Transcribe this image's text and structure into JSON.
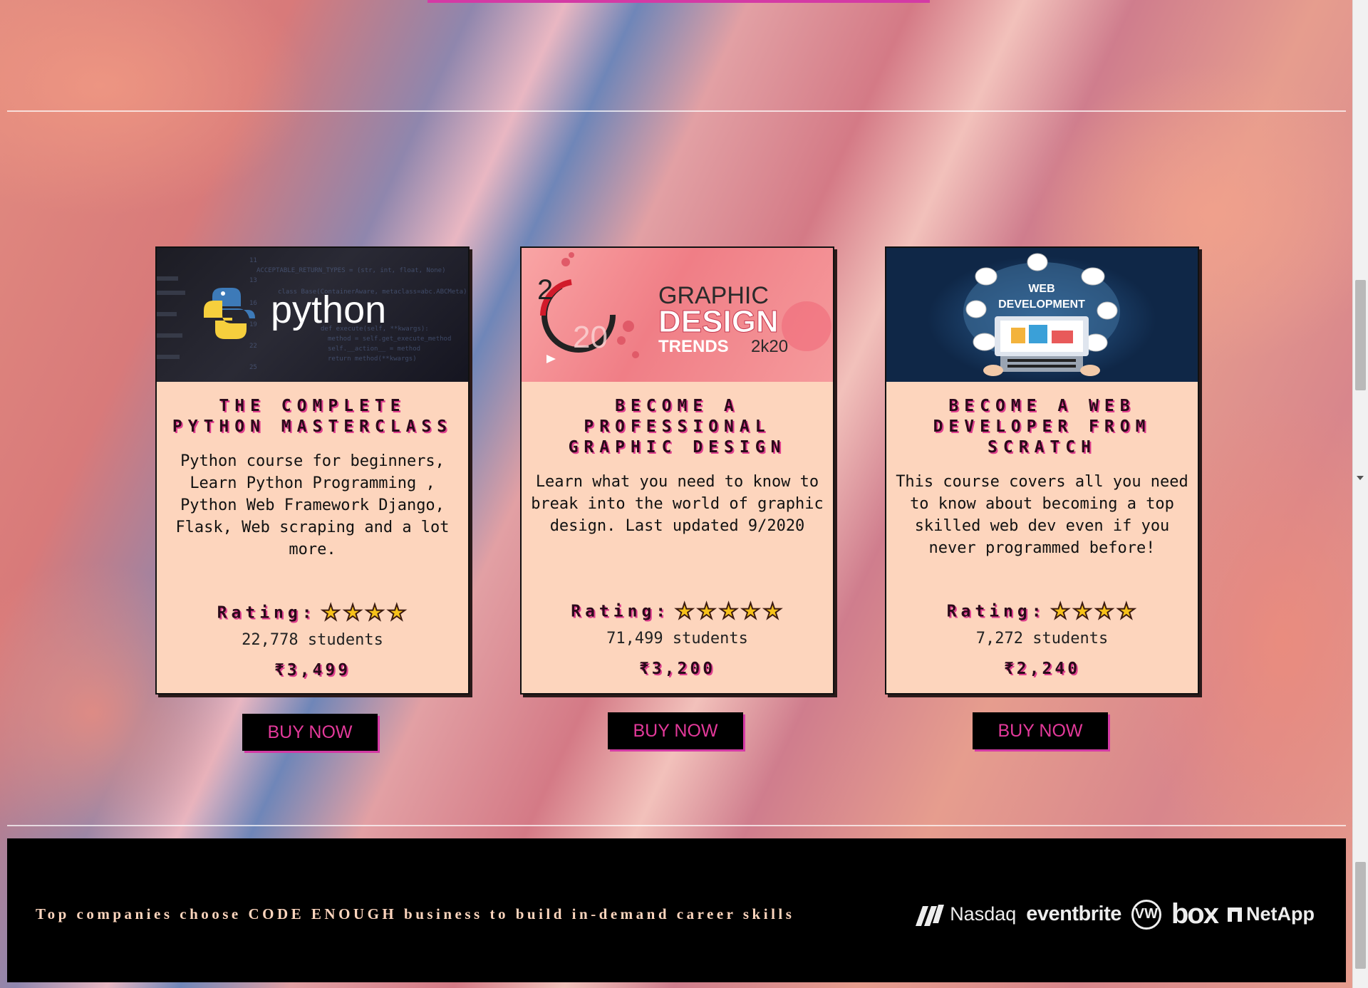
{
  "courses": [
    {
      "image_text": "python",
      "title": "THE COMPLETE PYTHON MASTERCLASS",
      "description": "Python course for beginners, Learn Python Programming , Python Web Framework Django, Flask, Web scraping and a lot more.",
      "rating_label": "Rating:",
      "stars": 4,
      "students": "22,778 students",
      "price": "₹3,499",
      "buy_label": "BUY NOW"
    },
    {
      "image_text": "GRAPHIC DESIGN TRENDS 2k20",
      "title": "BECOME A PROFESSIONAL GRAPHIC DESIGN",
      "description": "Learn what you need to know to break into the world of graphic design. Last updated 9/2020",
      "rating_label": "Rating:",
      "stars": 5,
      "students": "71,499 students",
      "price": "₹3,200",
      "buy_label": "BUY NOW"
    },
    {
      "image_text": "WEB DEVELOPMENT",
      "title": "BECOME A WEB DEVELOPER FROM SCRATCH",
      "description": "This course covers all you need to know about becoming a top skilled web dev even if you never programmed before!",
      "rating_label": "Rating:",
      "stars": 4,
      "students": "7,272 students",
      "price": "₹2,240",
      "buy_label": "BUY NOW"
    }
  ],
  "footer": {
    "tagline": "Top companies choose CODE ENOUGH business to build in-demand career skills",
    "logos": [
      "Nasdaq",
      "eventbrite",
      "VW",
      "box",
      "NetApp"
    ]
  },
  "colors": {
    "card_bg": "#fdd5bd",
    "accent_pink": "#e0408f",
    "button_text": "#e3399a",
    "star": "#f7c21a"
  }
}
